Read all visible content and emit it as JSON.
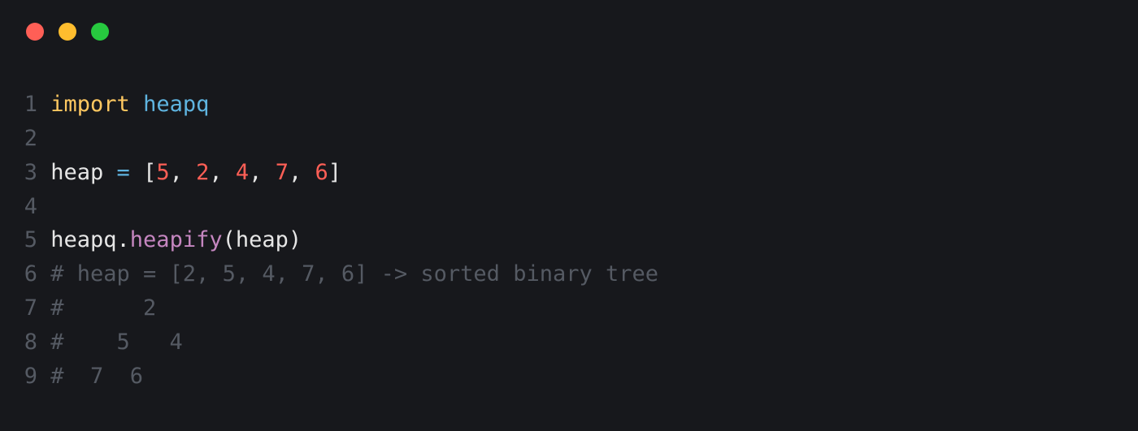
{
  "window": {
    "traffic_lights": {
      "close": "close",
      "minimize": "minimize",
      "zoom": "zoom"
    }
  },
  "code": {
    "line_numbers": [
      "1",
      "2",
      "3",
      "4",
      "5",
      "6",
      "7",
      "8",
      "9"
    ],
    "line1": {
      "kw": "import",
      "sp": " ",
      "mod": "heapq"
    },
    "line2": {
      "text": ""
    },
    "line3": {
      "ident": "heap",
      "sp1": " ",
      "op": "=",
      "sp2": " ",
      "lbr": "[",
      "n1": "5",
      "c1": ", ",
      "n2": "2",
      "c2": ", ",
      "n3": "4",
      "c3": ", ",
      "n4": "7",
      "c4": ", ",
      "n5": "6",
      "rbr": "]"
    },
    "line4": {
      "text": ""
    },
    "line5": {
      "obj": "heapq",
      "dot": ".",
      "func": "heapify",
      "lp": "(",
      "arg": "heap",
      "rp": ")"
    },
    "line6": {
      "comment": "# heap = [2, 5, 4, 7, 6] -> sorted binary tree"
    },
    "line7": {
      "comment": "#      2"
    },
    "line8": {
      "comment": "#    5   4"
    },
    "line9": {
      "comment": "#  7  6"
    }
  }
}
